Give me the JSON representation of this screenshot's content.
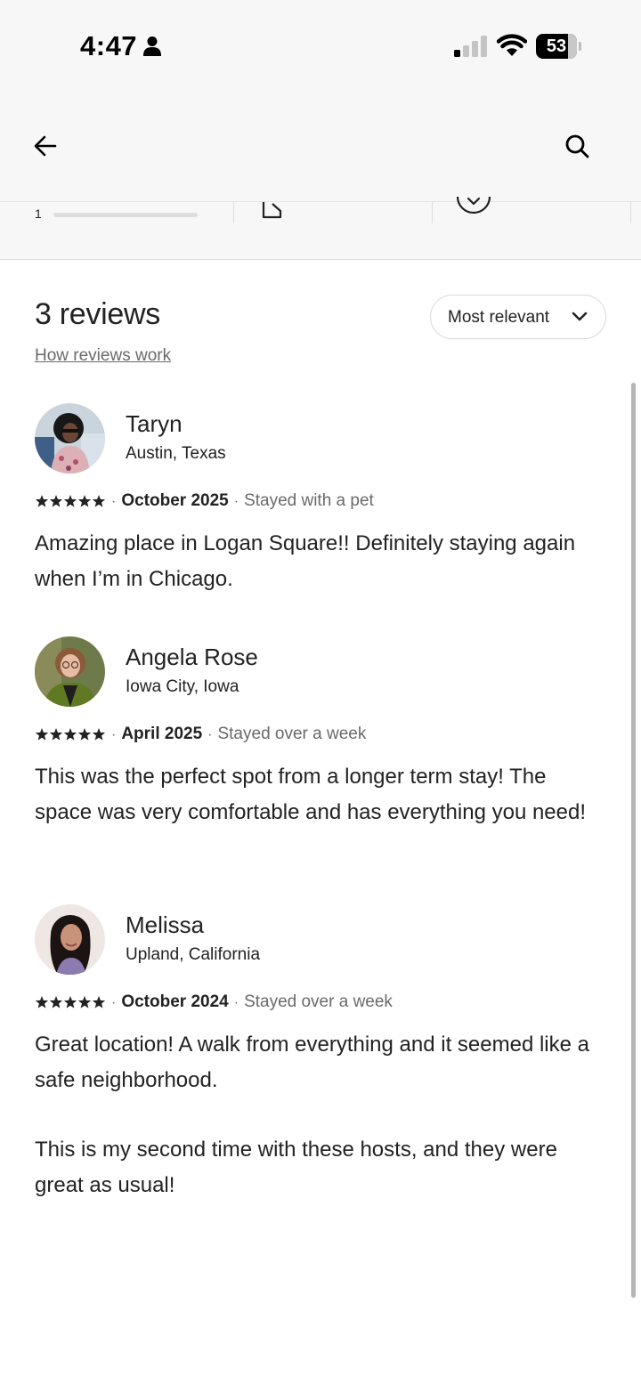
{
  "status_bar": {
    "time": "4:47",
    "battery": "53"
  },
  "reviews_header": {
    "title": "3 reviews",
    "sort_label": "Most relevant",
    "how_link": "How reviews work"
  },
  "rating_strip": {
    "row_number": "1"
  },
  "reviews": [
    {
      "name": "Taryn",
      "location": "Austin, Texas",
      "rating": 5,
      "date": "October 2025",
      "note": "Stayed with a pet",
      "paragraphs": [
        "Amazing place in Logan Square!! Definitely staying again when I’m in Chicago."
      ]
    },
    {
      "name": "Angela Rose",
      "location": "Iowa City, Iowa",
      "rating": 5,
      "date": "April 2025",
      "note": "Stayed over a week",
      "paragraphs": [
        "This was the perfect spot from a longer term stay! The space was very comfortable and has everything you need!"
      ]
    },
    {
      "name": "Melissa",
      "location": "Upland, California",
      "rating": 5,
      "date": "October 2024",
      "note": "Stayed over a week",
      "paragraphs": [
        "Great location! A walk from everything and it seemed like a safe neighborhood.",
        "This is my second time with these hosts, and they were great as usual!"
      ]
    }
  ],
  "colors": {
    "text_primary": "#222222",
    "text_secondary": "#6a6a6a",
    "header_bg": "#f7f7f7"
  }
}
